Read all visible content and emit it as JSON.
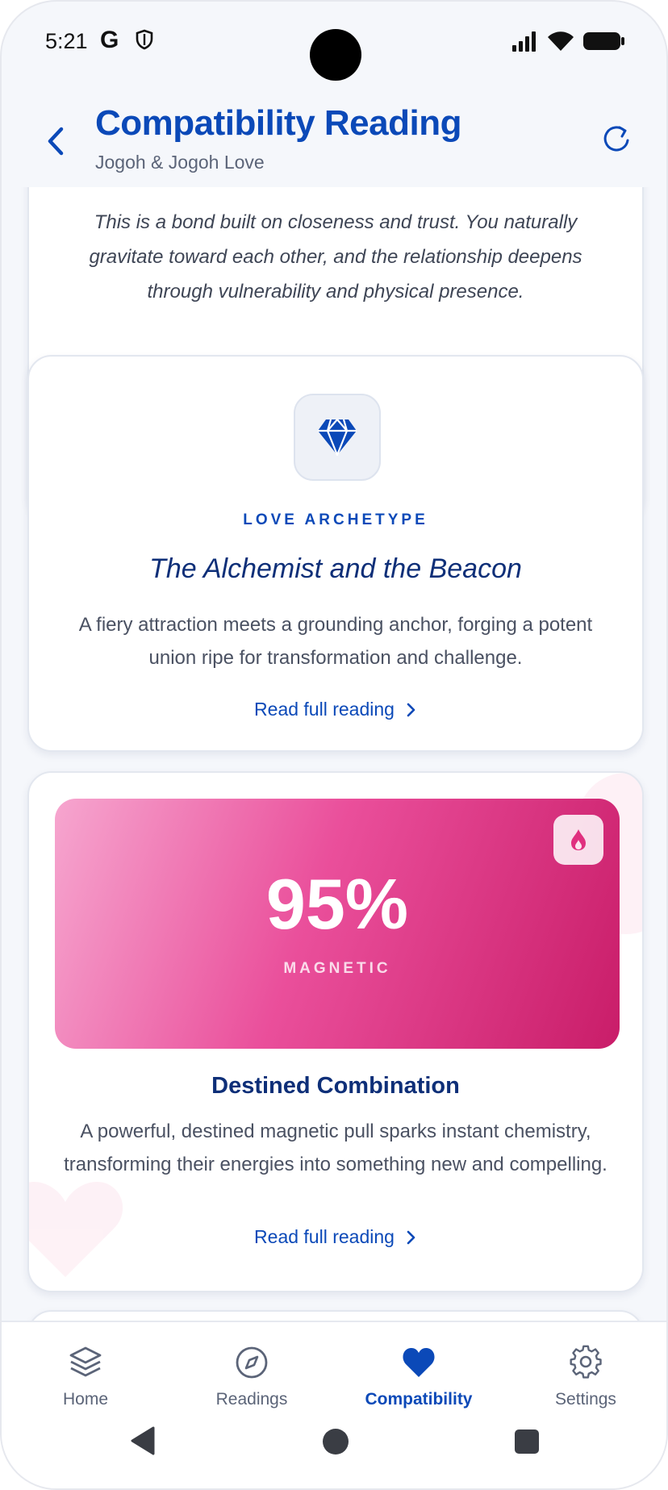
{
  "status_bar": {
    "time": "5:21",
    "g_label": "G"
  },
  "header": {
    "title": "Compatibility Reading",
    "subtitle": "Jogoh & Jogoh Love"
  },
  "intro_card": {
    "text": "This is a bond built on closeness and trust. You naturally gravitate toward each other, and the relationship deepens through vulnerability and physical presence."
  },
  "archetype_card": {
    "kicker": "LOVE ARCHETYPE",
    "title": "The Alchemist and the Beacon",
    "description": "A fiery attraction meets a grounding anchor, forging a potent union ripe for transformation and challenge.",
    "link": "Read full reading",
    "icon": "diamond-icon"
  },
  "score_card": {
    "score": "95%",
    "label": "MAGNETIC",
    "title": "Destined Combination",
    "description": "A powerful, destined magnetic pull sparks instant chemistry, transforming their energies into something new and compelling.",
    "link": "Read full reading",
    "icon": "flame-icon"
  },
  "bottom_nav": {
    "items": [
      {
        "label": "Home",
        "icon": "layers-icon"
      },
      {
        "label": "Readings",
        "icon": "compass-icon"
      },
      {
        "label": "Compatibility",
        "icon": "heart-icon",
        "active": true
      },
      {
        "label": "Settings",
        "icon": "gear-icon"
      }
    ]
  },
  "colors": {
    "accent": "#0b49b8",
    "heading": "#0e2f78",
    "pink_start": "#f6a6cf",
    "pink_end": "#c91d69"
  }
}
